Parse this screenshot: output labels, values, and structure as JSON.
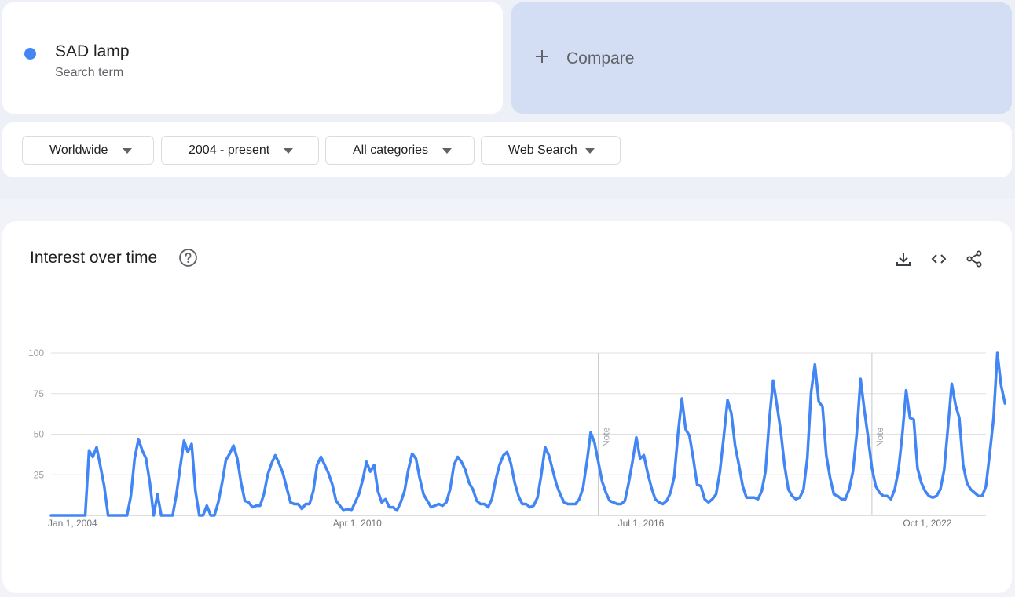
{
  "search_term": {
    "name": "SAD lamp",
    "subtitle": "Search term",
    "color": "#4285f4"
  },
  "compare": {
    "label": "Compare"
  },
  "filters": [
    {
      "label": "Worldwide"
    },
    {
      "label": "2004 - present"
    },
    {
      "label": "All categories"
    },
    {
      "label": "Web Search"
    }
  ],
  "chart_panel": {
    "title": "Interest over time",
    "actions": [
      "download-icon",
      "embed-code-icon",
      "share-icon"
    ]
  },
  "chart_data": {
    "type": "line",
    "title": "",
    "xlabel": "",
    "ylabel": "",
    "ylim": [
      0,
      100
    ],
    "yticks": [
      25,
      50,
      75,
      100
    ],
    "x_range": [
      "2004-01",
      "2024-07"
    ],
    "x_ticks": [
      {
        "date": "2004-01",
        "label": "Jan 1, 2004"
      },
      {
        "date": "2010-04",
        "label": "Apr 1, 2010"
      },
      {
        "date": "2016-07",
        "label": "Jul 1, 2016"
      },
      {
        "date": "2022-10",
        "label": "Oct 1, 2022"
      }
    ],
    "annotations": [
      {
        "date": "2016-01",
        "text": "Note"
      },
      {
        "date": "2022-01",
        "text": "Note"
      }
    ],
    "grid": true,
    "series": [
      {
        "color": "#4285f4",
        "points": [
          [
            "2004-01",
            0
          ],
          [
            "2004-06",
            0
          ],
          [
            "2004-09",
            0
          ],
          [
            "2004-10",
            0
          ],
          [
            "2004-11",
            40
          ],
          [
            "2004-12",
            36
          ],
          [
            "2005-01",
            42
          ],
          [
            "2005-02",
            30
          ],
          [
            "2005-03",
            18
          ],
          [
            "2005-04",
            0
          ],
          [
            "2005-09",
            0
          ],
          [
            "2005-10",
            12
          ],
          [
            "2005-11",
            35
          ],
          [
            "2005-12",
            47
          ],
          [
            "2006-01",
            40
          ],
          [
            "2006-02",
            35
          ],
          [
            "2006-03",
            20
          ],
          [
            "2006-04",
            0
          ],
          [
            "2006-05",
            13
          ],
          [
            "2006-06",
            0
          ],
          [
            "2006-09",
            0
          ],
          [
            "2006-10",
            13
          ],
          [
            "2006-11",
            30
          ],
          [
            "2006-12",
            46
          ],
          [
            "2007-01",
            39
          ],
          [
            "2007-02",
            44
          ],
          [
            "2007-03",
            15
          ],
          [
            "2007-04",
            0
          ],
          [
            "2007-05",
            0
          ],
          [
            "2007-06",
            6
          ],
          [
            "2007-07",
            0
          ],
          [
            "2007-08",
            0
          ],
          [
            "2007-09",
            8
          ],
          [
            "2007-10",
            20
          ],
          [
            "2007-11",
            34
          ],
          [
            "2007-12",
            38
          ],
          [
            "2008-01",
            43
          ],
          [
            "2008-02",
            35
          ],
          [
            "2008-03",
            20
          ],
          [
            "2008-04",
            9
          ],
          [
            "2008-05",
            8
          ],
          [
            "2008-06",
            5
          ],
          [
            "2008-07",
            6
          ],
          [
            "2008-08",
            6
          ],
          [
            "2008-09",
            13
          ],
          [
            "2008-10",
            25
          ],
          [
            "2008-11",
            32
          ],
          [
            "2008-12",
            37
          ],
          [
            "2009-01",
            32
          ],
          [
            "2009-02",
            26
          ],
          [
            "2009-03",
            17
          ],
          [
            "2009-04",
            8
          ],
          [
            "2009-05",
            7
          ],
          [
            "2009-06",
            7
          ],
          [
            "2009-07",
            4
          ],
          [
            "2009-08",
            7
          ],
          [
            "2009-09",
            7
          ],
          [
            "2009-10",
            15
          ],
          [
            "2009-11",
            31
          ],
          [
            "2009-12",
            36
          ],
          [
            "2010-01",
            31
          ],
          [
            "2010-02",
            26
          ],
          [
            "2010-03",
            19
          ],
          [
            "2010-04",
            9
          ],
          [
            "2010-05",
            6
          ],
          [
            "2010-06",
            3
          ],
          [
            "2010-07",
            4
          ],
          [
            "2010-08",
            3
          ],
          [
            "2010-09",
            8
          ],
          [
            "2010-10",
            13
          ],
          [
            "2010-11",
            22
          ],
          [
            "2010-12",
            33
          ],
          [
            "2011-01",
            27
          ],
          [
            "2011-02",
            31
          ],
          [
            "2011-03",
            15
          ],
          [
            "2011-04",
            8
          ],
          [
            "2011-05",
            10
          ],
          [
            "2011-06",
            5
          ],
          [
            "2011-07",
            5
          ],
          [
            "2011-08",
            3
          ],
          [
            "2011-09",
            8
          ],
          [
            "2011-10",
            15
          ],
          [
            "2011-11",
            28
          ],
          [
            "2011-12",
            38
          ],
          [
            "2012-01",
            35
          ],
          [
            "2012-02",
            23
          ],
          [
            "2012-03",
            13
          ],
          [
            "2012-04",
            9
          ],
          [
            "2012-05",
            5
          ],
          [
            "2012-06",
            6
          ],
          [
            "2012-07",
            7
          ],
          [
            "2012-08",
            6
          ],
          [
            "2012-09",
            8
          ],
          [
            "2012-10",
            16
          ],
          [
            "2012-11",
            31
          ],
          [
            "2012-12",
            36
          ],
          [
            "2013-01",
            33
          ],
          [
            "2013-02",
            28
          ],
          [
            "2013-03",
            20
          ],
          [
            "2013-04",
            16
          ],
          [
            "2013-05",
            9
          ],
          [
            "2013-06",
            7
          ],
          [
            "2013-07",
            7
          ],
          [
            "2013-08",
            5
          ],
          [
            "2013-09",
            10
          ],
          [
            "2013-10",
            22
          ],
          [
            "2013-11",
            31
          ],
          [
            "2013-12",
            37
          ],
          [
            "2014-01",
            39
          ],
          [
            "2014-02",
            32
          ],
          [
            "2014-03",
            20
          ],
          [
            "2014-04",
            12
          ],
          [
            "2014-05",
            7
          ],
          [
            "2014-06",
            7
          ],
          [
            "2014-07",
            5
          ],
          [
            "2014-08",
            6
          ],
          [
            "2014-09",
            11
          ],
          [
            "2014-10",
            25
          ],
          [
            "2014-11",
            42
          ],
          [
            "2014-12",
            37
          ],
          [
            "2015-01",
            28
          ],
          [
            "2015-02",
            19
          ],
          [
            "2015-03",
            13
          ],
          [
            "2015-04",
            8
          ],
          [
            "2015-05",
            7
          ],
          [
            "2015-06",
            7
          ],
          [
            "2015-07",
            7
          ],
          [
            "2015-08",
            10
          ],
          [
            "2015-09",
            17
          ],
          [
            "2015-10",
            33
          ],
          [
            "2015-11",
            51
          ],
          [
            "2015-12",
            45
          ],
          [
            "2016-01",
            33
          ],
          [
            "2016-02",
            21
          ],
          [
            "2016-03",
            14
          ],
          [
            "2016-04",
            9
          ],
          [
            "2016-05",
            8
          ],
          [
            "2016-06",
            7
          ],
          [
            "2016-07",
            7
          ],
          [
            "2016-08",
            9
          ],
          [
            "2016-09",
            20
          ],
          [
            "2016-10",
            33
          ],
          [
            "2016-11",
            48
          ],
          [
            "2016-12",
            35
          ],
          [
            "2017-01",
            37
          ],
          [
            "2017-02",
            26
          ],
          [
            "2017-03",
            17
          ],
          [
            "2017-04",
            10
          ],
          [
            "2017-05",
            8
          ],
          [
            "2017-06",
            7
          ],
          [
            "2017-07",
            9
          ],
          [
            "2017-08",
            14
          ],
          [
            "2017-09",
            24
          ],
          [
            "2017-10",
            51
          ],
          [
            "2017-11",
            72
          ],
          [
            "2017-12",
            53
          ],
          [
            "2018-01",
            49
          ],
          [
            "2018-02",
            35
          ],
          [
            "2018-03",
            19
          ],
          [
            "2018-04",
            18
          ],
          [
            "2018-05",
            10
          ],
          [
            "2018-06",
            8
          ],
          [
            "2018-07",
            10
          ],
          [
            "2018-08",
            13
          ],
          [
            "2018-09",
            27
          ],
          [
            "2018-10",
            48
          ],
          [
            "2018-11",
            71
          ],
          [
            "2018-12",
            63
          ],
          [
            "2019-01",
            43
          ],
          [
            "2019-02",
            31
          ],
          [
            "2019-03",
            18
          ],
          [
            "2019-04",
            11
          ],
          [
            "2019-05",
            11
          ],
          [
            "2019-06",
            11
          ],
          [
            "2019-07",
            10
          ],
          [
            "2019-08",
            15
          ],
          [
            "2019-09",
            27
          ],
          [
            "2019-10",
            59
          ],
          [
            "2019-11",
            83
          ],
          [
            "2019-12",
            68
          ],
          [
            "2020-01",
            52
          ],
          [
            "2020-02",
            31
          ],
          [
            "2020-03",
            16
          ],
          [
            "2020-04",
            12
          ],
          [
            "2020-05",
            10
          ],
          [
            "2020-06",
            11
          ],
          [
            "2020-07",
            16
          ],
          [
            "2020-08",
            35
          ],
          [
            "2020-09",
            76
          ],
          [
            "2020-10",
            93
          ],
          [
            "2020-11",
            70
          ],
          [
            "2020-12",
            67
          ],
          [
            "2021-01",
            37
          ],
          [
            "2021-02",
            23
          ],
          [
            "2021-03",
            13
          ],
          [
            "2021-04",
            12
          ],
          [
            "2021-05",
            10
          ],
          [
            "2021-06",
            10
          ],
          [
            "2021-07",
            16
          ],
          [
            "2021-08",
            27
          ],
          [
            "2021-09",
            50
          ],
          [
            "2021-10",
            84
          ],
          [
            "2021-11",
            65
          ],
          [
            "2021-12",
            48
          ],
          [
            "2022-01",
            29
          ],
          [
            "2022-02",
            18
          ],
          [
            "2022-03",
            14
          ],
          [
            "2022-04",
            12
          ],
          [
            "2022-05",
            12
          ],
          [
            "2022-06",
            10
          ],
          [
            "2022-07",
            16
          ],
          [
            "2022-08",
            28
          ],
          [
            "2022-09",
            50
          ],
          [
            "2022-10",
            77
          ],
          [
            "2022-11",
            60
          ],
          [
            "2022-12",
            59
          ],
          [
            "2023-01",
            29
          ],
          [
            "2023-02",
            20
          ],
          [
            "2023-03",
            15
          ],
          [
            "2023-04",
            12
          ],
          [
            "2023-05",
            11
          ],
          [
            "2023-06",
            12
          ],
          [
            "2023-07",
            16
          ],
          [
            "2023-08",
            28
          ],
          [
            "2023-09",
            54
          ],
          [
            "2023-10",
            81
          ],
          [
            "2023-11",
            68
          ],
          [
            "2023-12",
            60
          ],
          [
            "2024-01",
            31
          ],
          [
            "2024-02",
            20
          ],
          [
            "2024-03",
            16
          ],
          [
            "2024-04",
            14
          ],
          [
            "2024-05",
            12
          ],
          [
            "2024-06",
            12
          ],
          [
            "2024-07",
            18
          ],
          [
            "2024-08",
            38
          ],
          [
            "2024-09",
            60
          ],
          [
            "2024-10",
            100
          ],
          [
            "2024-11",
            80
          ],
          [
            "2024-12",
            69
          ]
        ]
      }
    ]
  }
}
